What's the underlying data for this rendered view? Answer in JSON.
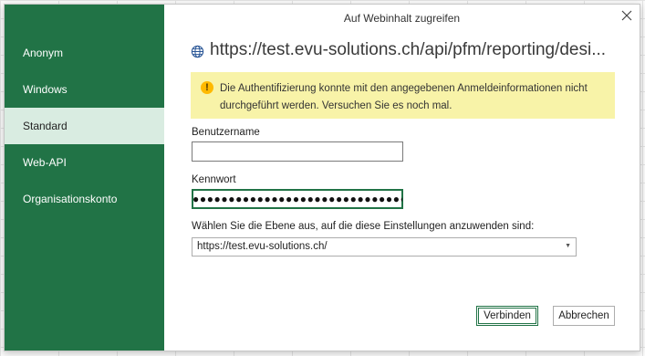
{
  "dialog": {
    "title": "Auf Webinhalt zugreifen",
    "url": "https://test.evu-solutions.ch/api/pfm/reporting/desi..."
  },
  "sidebar": {
    "items": [
      {
        "label": "Anonym"
      },
      {
        "label": "Windows"
      },
      {
        "label": "Standard",
        "active": true
      },
      {
        "label": "Web-API"
      },
      {
        "label": "Organisationskonto"
      }
    ]
  },
  "warning": {
    "icon": "warning-icon",
    "text": "Die Authentifizierung konnte mit den angegebenen Anmeldeinformationen nicht durchgeführt werden. Versuchen Sie es noch mal."
  },
  "form": {
    "username_label": "Benutzername",
    "username_value": "",
    "password_label": "Kennwort",
    "password_masked": "●●●●●●●●●●●●●●●●●●●●●●●●●●●●●●●●",
    "level_label": "Wählen Sie die Ebene aus, auf die diese Einstellungen anzuwenden sind:",
    "level_value": "https://test.evu-solutions.ch/"
  },
  "buttons": {
    "connect": "Verbinden",
    "cancel": "Abbrechen"
  },
  "colors": {
    "sidebar": "#217346",
    "sidebar_active": "#d9ece1",
    "warning_bg": "#f8f3a8",
    "warning_icon": "#ffb900"
  }
}
